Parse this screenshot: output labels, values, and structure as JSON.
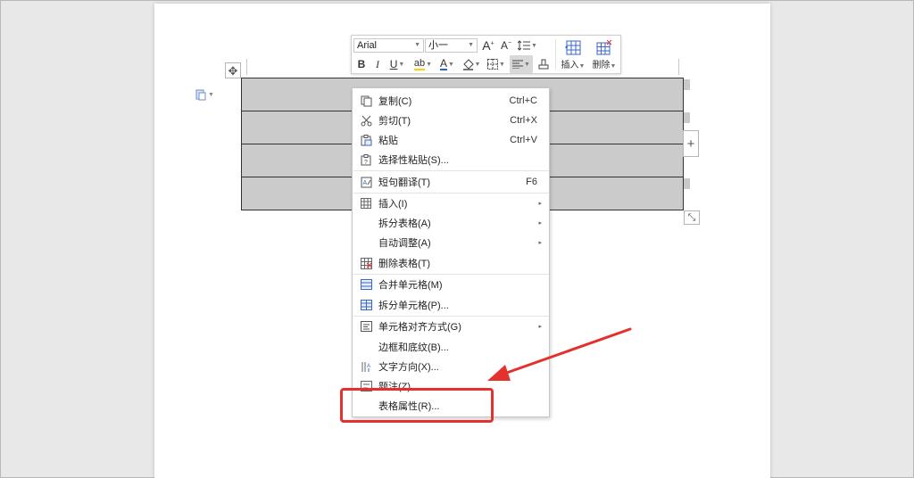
{
  "toolbar": {
    "font_name": "Arial",
    "font_size": "小一",
    "insert_label": "插入",
    "delete_label": "删除"
  },
  "context_menu": {
    "items": [
      {
        "label": "复制(C)",
        "shortcut": "Ctrl+C",
        "icon": "copy-icon"
      },
      {
        "label": "剪切(T)",
        "shortcut": "Ctrl+X",
        "icon": "scissors-icon"
      },
      {
        "label": "粘贴",
        "shortcut": "Ctrl+V",
        "icon": "paste-icon"
      },
      {
        "label": "选择性粘贴(S)...",
        "shortcut": "",
        "icon": "paste-special-icon"
      },
      {
        "label": "短句翻译(T)",
        "shortcut": "F6",
        "icon": "translate-icon"
      },
      {
        "label": "插入(I)",
        "shortcut": "",
        "icon": "insert-table-icon"
      },
      {
        "label": "拆分表格(A)",
        "shortcut": "",
        "icon": ""
      },
      {
        "label": "自动调整(A)",
        "shortcut": "",
        "icon": ""
      },
      {
        "label": "删除表格(T)",
        "shortcut": "",
        "icon": "delete-table-icon"
      },
      {
        "label": "合并单元格(M)",
        "shortcut": "",
        "icon": "merge-cells-icon"
      },
      {
        "label": "拆分单元格(P)...",
        "shortcut": "",
        "icon": "split-cells-icon"
      },
      {
        "label": "单元格对齐方式(G)",
        "shortcut": "",
        "icon": "cell-align-icon"
      },
      {
        "label": "边框和底纹(B)...",
        "shortcut": "",
        "icon": ""
      },
      {
        "label": "文字方向(X)...",
        "shortcut": "",
        "icon": "text-direction-icon"
      },
      {
        "label": "题注(Z)...",
        "shortcut": "",
        "icon": "caption-icon"
      },
      {
        "label": "表格属性(R)...",
        "shortcut": "",
        "icon": ""
      }
    ]
  },
  "colors": {
    "highlight": "#e3312d",
    "table_fill": "#cbcbcb",
    "font_color_underline": "#2b5fd9"
  }
}
